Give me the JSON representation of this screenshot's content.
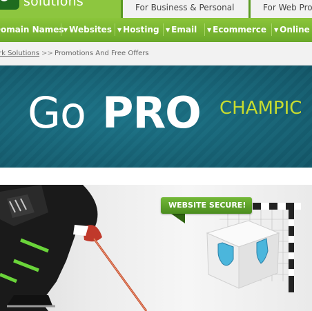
{
  "header": {
    "logo_text": "solutions",
    "tabs": [
      {
        "label": "For Business & Personal"
      },
      {
        "label": "For Web Pro"
      }
    ]
  },
  "nav": {
    "items": [
      {
        "label": "Domain Names"
      },
      {
        "label": "Websites"
      },
      {
        "label": "Hosting"
      },
      {
        "label": "Email"
      },
      {
        "label": "Ecommerce"
      },
      {
        "label": "Online"
      }
    ]
  },
  "breadcrumb": {
    "root": "rk Solutions",
    "separator": ">>",
    "current": "Promotions And Free Offers"
  },
  "banner": {
    "go": "Go",
    "pro": "PRO",
    "tagline": "CHAMPIC"
  },
  "promo": {
    "badge": "WEBSITE SECURE!"
  },
  "colors": {
    "brand_green": "#8dc63f",
    "nav_green": "#6aa82a",
    "banner_teal": "#1a6a7e",
    "tagline_lime": "#c8dc2e",
    "badge_green": "#5aa22a"
  }
}
